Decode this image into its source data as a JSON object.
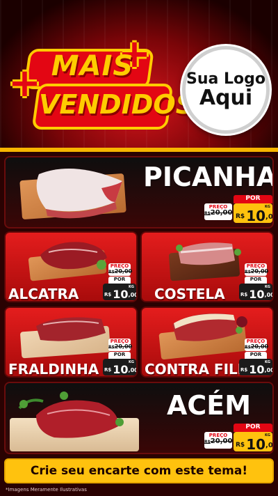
{
  "header": {
    "badge_line1": "MAIS",
    "badge_line2": "VENDIDOS",
    "logo_line1": "Sua Logo",
    "logo_line2": "Aqui"
  },
  "colors": {
    "brand_red": "#e30613",
    "accent_gold": "#ffc20e",
    "dark": "#1b1b1b"
  },
  "products": [
    {
      "name": "PICANHA",
      "old_label": "PREÇO",
      "old_price": "20,00",
      "old_prefix": "R$",
      "por_label": "POR",
      "currency": "R$",
      "price": "10",
      "cents": ",00",
      "unit": "KG"
    },
    {
      "name": "ALCATRA",
      "old_label": "PREÇO",
      "old_price": "20,00",
      "old_prefix": "R$",
      "por_label": "POR",
      "currency": "R$",
      "price": "10",
      "cents": ",00",
      "unit": "KG"
    },
    {
      "name": "COSTELA",
      "old_label": "PREÇO",
      "old_price": "20,00",
      "old_prefix": "R$",
      "por_label": "POR",
      "currency": "R$",
      "price": "10",
      "cents": ",00",
      "unit": "KG"
    },
    {
      "name": "FRALDINHA",
      "old_label": "PREÇO",
      "old_price": "20,00",
      "old_prefix": "R$",
      "por_label": "POR",
      "currency": "R$",
      "price": "10",
      "cents": ",00",
      "unit": "KG"
    },
    {
      "name": "CONTRA FILÉ",
      "old_label": "PREÇO",
      "old_price": "20,00",
      "old_prefix": "R$",
      "por_label": "POR",
      "currency": "R$",
      "price": "10",
      "cents": ",00",
      "unit": "KG"
    },
    {
      "name": "ACÉM",
      "old_label": "PREÇO",
      "old_price": "20,00",
      "old_prefix": "R$",
      "por_label": "POR",
      "currency": "R$",
      "price": "10",
      "cents": ",00",
      "unit": "KG"
    }
  ],
  "cta": {
    "label": "Crie seu encarte com este tema!"
  },
  "footnote": "*Imagens Meramente Ilustrativas"
}
